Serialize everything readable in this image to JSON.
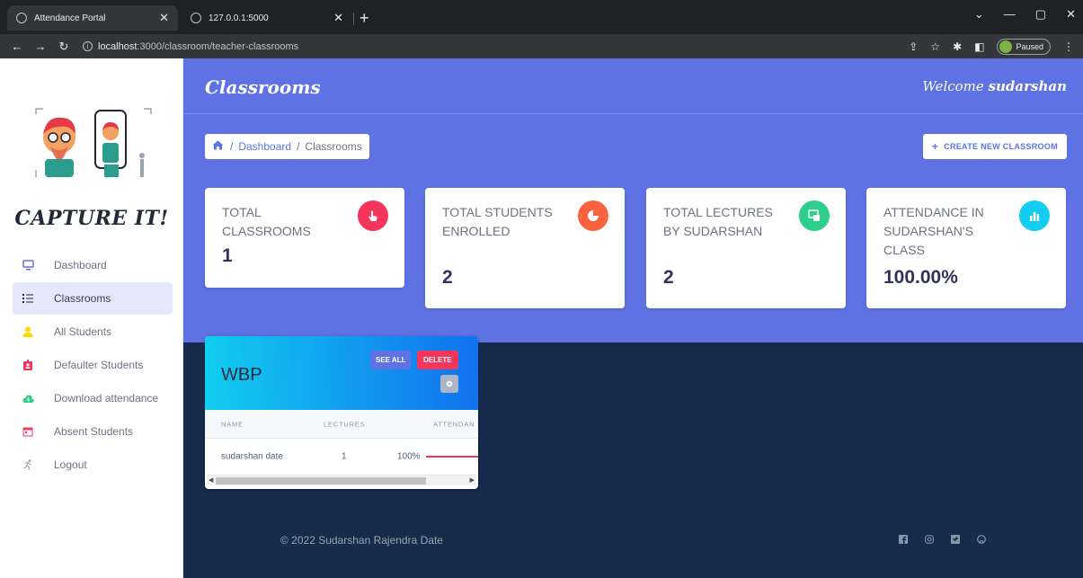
{
  "browser": {
    "tabs": [
      {
        "title": "Attendance Portal",
        "active": true
      },
      {
        "title": "127.0.0.1:5000",
        "active": false
      }
    ],
    "url_host": "localhost",
    "url_path": ":3000/classroom/teacher-classrooms",
    "paused_label": "Paused"
  },
  "sidebar": {
    "brand": "CAPTURE IT!",
    "items": [
      {
        "label": "Dashboard",
        "icon": "monitor-icon",
        "color": "#5e72e4",
        "active": false
      },
      {
        "label": "Classrooms",
        "icon": "list-icon",
        "color": "#1f2937",
        "active": true
      },
      {
        "label": "All Students",
        "icon": "user-icon",
        "color": "#ffd600",
        "active": false
      },
      {
        "label": "Defaulter Students",
        "icon": "id-badge-icon",
        "color": "#f5365c",
        "active": false
      },
      {
        "label": "Download attendance",
        "icon": "cloud-download-icon",
        "color": "#2dce89",
        "active": false
      },
      {
        "label": "Absent Students",
        "icon": "calendar-icon",
        "color": "#f5365c",
        "active": false
      },
      {
        "label": "Logout",
        "icon": "running-icon",
        "color": "#9ca3af",
        "active": false
      }
    ]
  },
  "header": {
    "title": "Classrooms",
    "welcome_prefix": "Welcome",
    "welcome_user": "sudarshan"
  },
  "breadcrumb": {
    "home_icon": "home-icon",
    "items": [
      "Dashboard",
      "Classrooms"
    ]
  },
  "create_button": "CREATE NEW CLASSROOM",
  "stats": [
    {
      "label": "TOTAL CLASSROOMS",
      "value": "1",
      "icon": "hand-pointer-icon",
      "color": "#f5365c"
    },
    {
      "label": "TOTAL STUDENTS ENROLLED",
      "value": "2",
      "icon": "pie-chart-icon",
      "color": "#fb6340"
    },
    {
      "label": "TOTAL LECTURES BY SUDARSHAN",
      "value": "2",
      "icon": "lectures-icon",
      "color": "#2dce89"
    },
    {
      "label": "ATTENDANCE IN SUDARSHAN'S CLASS",
      "value": "100.00%",
      "icon": "bar-chart-icon",
      "color": "#11cdef"
    }
  ],
  "classroom": {
    "name": "WBP",
    "see_all": "SEE ALL",
    "delete": "DELETE",
    "columns": [
      "NAME",
      "LECTURES",
      "ATTENDAN"
    ],
    "rows": [
      {
        "name": "sudarshan date",
        "lectures": "1",
        "attendance": "100%",
        "progress": 1.0
      }
    ]
  },
  "footer": {
    "copyright": "© 2022 Sudarshan Rajendra Date",
    "social": [
      "facebook-icon",
      "instagram-icon",
      "twitter-icon",
      "github-icon"
    ]
  }
}
